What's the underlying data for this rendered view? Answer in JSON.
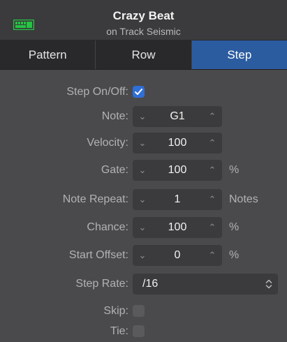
{
  "header": {
    "icon": "region-icon",
    "accent_color": "#25c443",
    "title": "Crazy Beat",
    "subtitle": "on Track Seismic"
  },
  "tabs": [
    {
      "label": "Pattern",
      "active": false
    },
    {
      "label": "Row",
      "active": false
    },
    {
      "label": "Step",
      "active": true
    }
  ],
  "active_tab_color": "#2c5ca0",
  "step": {
    "step_on_off": {
      "label": "Step On/Off:",
      "checked": true
    },
    "note": {
      "label": "Note:",
      "value": "G1"
    },
    "velocity": {
      "label": "Velocity:",
      "value": "100"
    },
    "gate": {
      "label": "Gate:",
      "value": "100",
      "unit": "%"
    },
    "note_repeat": {
      "label": "Note Repeat:",
      "value": "1",
      "unit": "Notes"
    },
    "chance": {
      "label": "Chance:",
      "value": "100",
      "unit": "%"
    },
    "start_offset": {
      "label": "Start Offset:",
      "value": "0",
      "unit": "%"
    },
    "step_rate": {
      "label": "Step Rate:",
      "value": "/16"
    },
    "skip": {
      "label": "Skip:",
      "checked": false
    },
    "tie": {
      "label": "Tie:",
      "checked": false
    }
  }
}
